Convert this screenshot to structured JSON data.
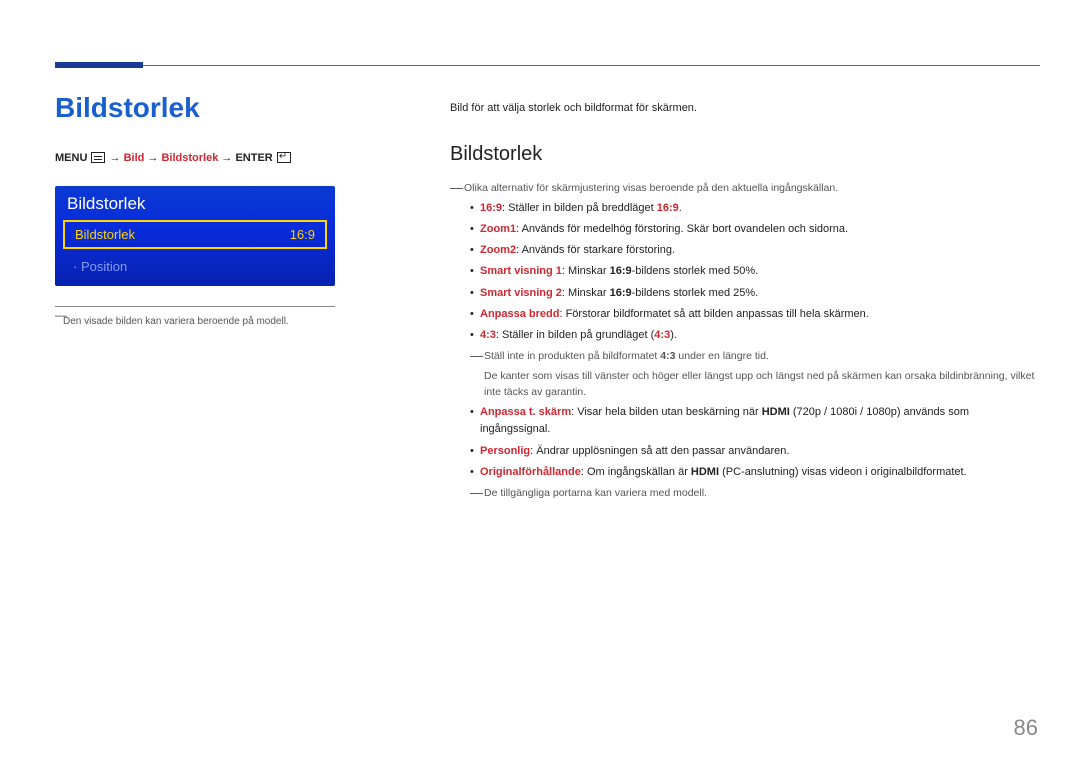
{
  "page": {
    "title": "Bildstorlek",
    "number": "86"
  },
  "breadcrumb": {
    "menu": "MENU",
    "seg1": "Bild",
    "seg2": "Bildstorlek",
    "enter": "ENTER"
  },
  "osd": {
    "title": "Bildstorlek",
    "selected_label": "Bildstorlek",
    "selected_value": "16:9",
    "disabled_label": "Position",
    "disabled_prefix": "· "
  },
  "left_footnote": "Den visade bilden kan variera beroende på modell.",
  "right": {
    "intro": "Bild för att välja storlek och bildformat för skärmen.",
    "heading": "Bildstorlek",
    "top_note": "Olika alternativ för skärmjustering visas beroende på den aktuella ingångskällan.",
    "items": [
      {
        "label": "16:9",
        "labelIsHL": true,
        "text1": ": Ställer in bilden på breddläget ",
        "tail": "16:9",
        "tailIsHL": true,
        "text2": "."
      },
      {
        "label": "Zoom1",
        "labelIsHL": true,
        "text1": ": Används för medelhög förstoring. Skär bort ovandelen och sidorna."
      },
      {
        "label": "Zoom2",
        "labelIsHL": true,
        "text1": ": Används för starkare förstoring."
      },
      {
        "label": "Smart visning 1",
        "labelIsHL": true,
        "text1": ": Minskar ",
        "mid": "16:9",
        "midIsStrong": true,
        "text2": "-bildens storlek med 50%."
      },
      {
        "label": "Smart visning 2",
        "labelIsHL": true,
        "text1": ": Minskar ",
        "mid": "16:9",
        "midIsStrong": true,
        "text2": "-bildens storlek med 25%."
      },
      {
        "label": "Anpassa bredd",
        "labelIsHL": true,
        "text1": ": Förstorar bildformatet så att bilden anpassas till hela skärmen."
      },
      {
        "label": "4:3",
        "labelIsHL": true,
        "text1": ": Ställer in bilden på grundläget (",
        "tail": "4:3",
        "tailIsHL": true,
        "text2": ")."
      }
    ],
    "sub_note1_a": "Ställ inte in produkten på bildformatet ",
    "sub_note1_b": "4:3",
    "sub_note1_c": " under en längre tid.",
    "sub_note2": "De kanter som visas till vänster och höger eller längst upp och längst ned på skärmen kan orsaka bildinbränning, vilket inte täcks av garantin.",
    "items2": [
      {
        "label": "Anpassa t. skärm",
        "labelIsHL": true,
        "text1": ": Visar hela bilden utan beskärning när ",
        "mid": "HDMI",
        "midIsStrong": true,
        "text2": " (720p / 1080i / 1080p) används som ingångssignal."
      },
      {
        "label": "Personlig",
        "labelIsHL": true,
        "text1": ": Ändrar upplösningen så att den passar användaren."
      },
      {
        "label": "Originalförhållande",
        "labelIsHL": true,
        "text1": ": Om ingångskällan är ",
        "mid": "HDMI",
        "midIsStrong": true,
        "text2": " (PC-anslutning) visas videon i originalbildformatet."
      }
    ],
    "bottom_note": "De tillgängliga portarna kan variera med modell."
  }
}
